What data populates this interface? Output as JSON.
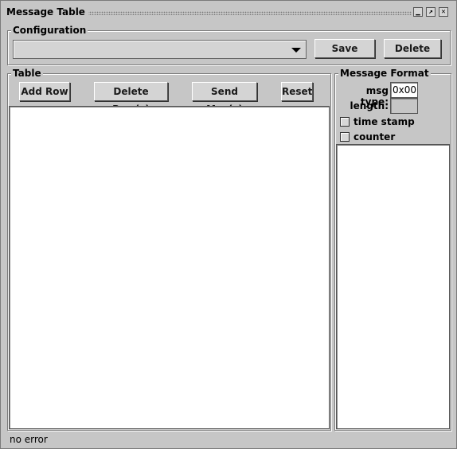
{
  "window": {
    "title": "Message Table",
    "controls": {
      "minimize": "▁",
      "maximize": "↗",
      "close": "✕"
    }
  },
  "configuration": {
    "group_title": "Configuration",
    "selected": "",
    "save_label": "Save",
    "delete_label": "Delete"
  },
  "table": {
    "group_title": "Table",
    "add_row_label": "Add Row",
    "delete_rows_label": "Delete Row(s)",
    "send_msg_label": "Send Msg(s)",
    "reset_label": "Reset"
  },
  "message_format": {
    "group_title": "Message Format",
    "msg_type_label": "msg type:",
    "msg_type_value": "0x00",
    "length_label": "length:",
    "length_value": "",
    "time_stamp_label": "time stamp",
    "time_stamp_checked": false,
    "counter_label": "counter",
    "counter_checked": false
  },
  "status_bar": {
    "text": "no error"
  },
  "colors": {
    "background": "#c6c6c6",
    "panel": "#ffffff"
  }
}
